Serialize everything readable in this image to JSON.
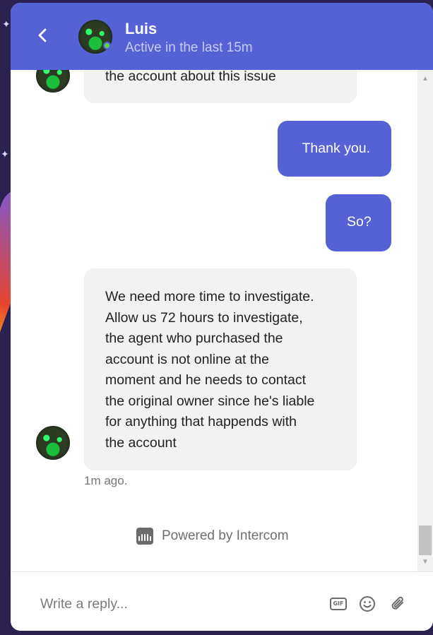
{
  "header": {
    "agent_name": "Luis",
    "agent_status": "Active in the last 15m",
    "online_color": "#5fd146",
    "accent": "#5562d6"
  },
  "messages": [
    {
      "sender": "agent",
      "text": "the account about this issue"
    },
    {
      "sender": "user",
      "text": "Thank you."
    },
    {
      "sender": "user",
      "text": "So?"
    },
    {
      "sender": "agent",
      "lines": [
        "We need more time to investigate.",
        "Allow us 72 hours to investigate,",
        "the agent who purchased the",
        "account is not online at the",
        "moment and he needs to contact",
        "the original owner since he's liable",
        "for anything that happends with",
        "the account"
      ]
    }
  ],
  "timestamp": "1m ago.",
  "powered_by": "Powered by Intercom",
  "composer": {
    "placeholder": "Write a reply...",
    "gif_label": "GIF",
    "icons": [
      "gif-icon",
      "emoji-icon",
      "attachment-icon"
    ]
  }
}
